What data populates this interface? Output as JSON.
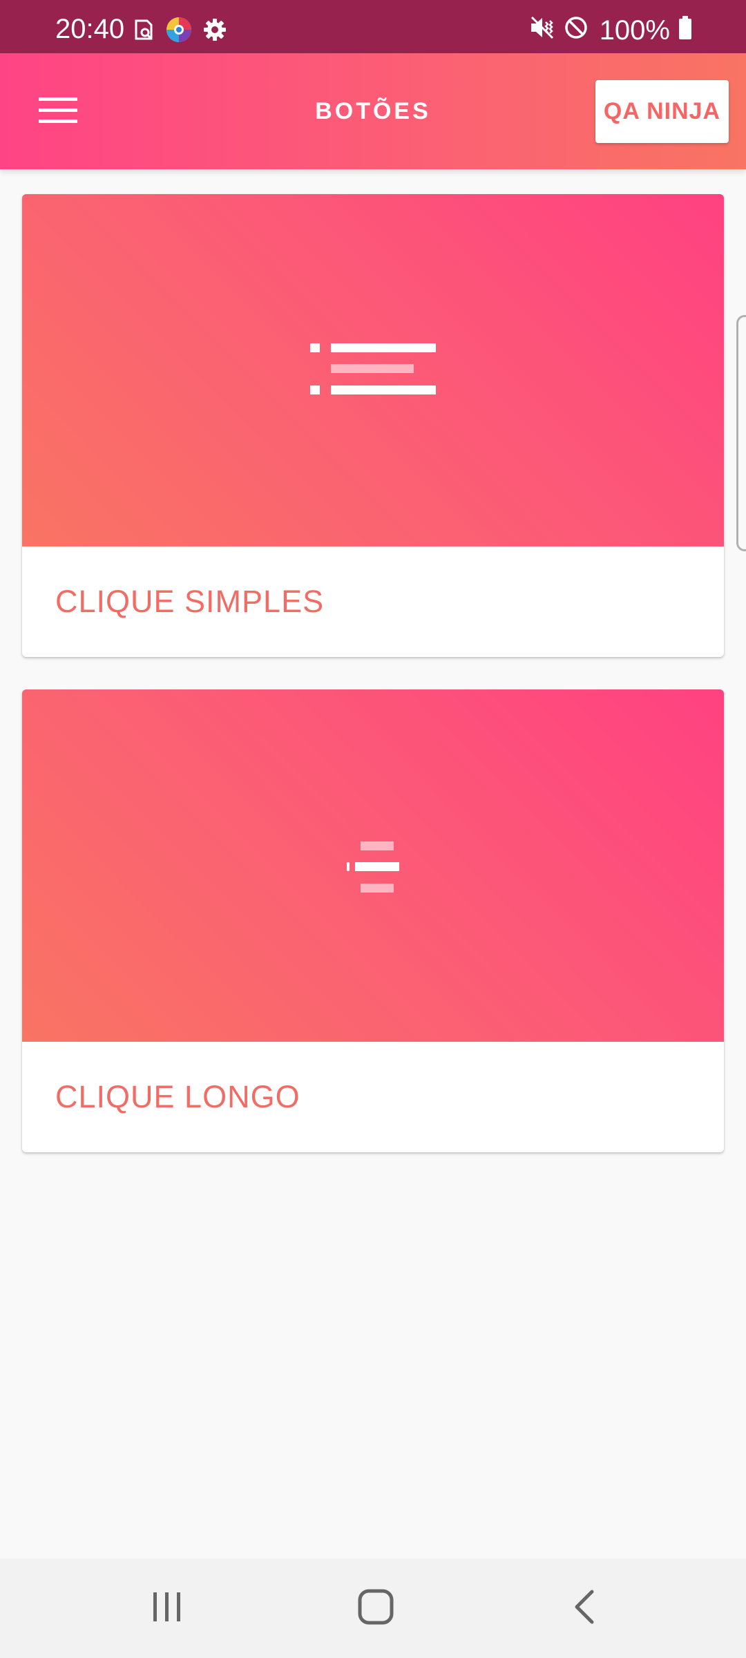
{
  "status_bar": {
    "time": "20:40",
    "battery_percent": "100%",
    "left_icons": [
      "screen-search-icon",
      "browser-app-icon",
      "settings-gear-icon"
    ],
    "right_icons": [
      "vibrate-mute-icon",
      "do-not-disturb-icon",
      "battery-icon"
    ]
  },
  "app_bar": {
    "title": "BOTÕES",
    "menu_icon": "hamburger-menu-icon",
    "action_label": "QA NINJA"
  },
  "cards": [
    {
      "label": "CLIQUE SIMPLES",
      "icon": "list-placeholder-icon"
    },
    {
      "label": "CLIQUE LONGO",
      "icon": "list-placeholder-icon"
    }
  ],
  "nav_bar": {
    "buttons": [
      "recent-apps-icon",
      "home-icon",
      "back-icon"
    ]
  },
  "colors": {
    "status_bar": "#97224d",
    "accent_pink": "#ff4485",
    "accent_coral": "#f97463",
    "label_text": "#f26c66",
    "background": "#f9f9f9"
  }
}
